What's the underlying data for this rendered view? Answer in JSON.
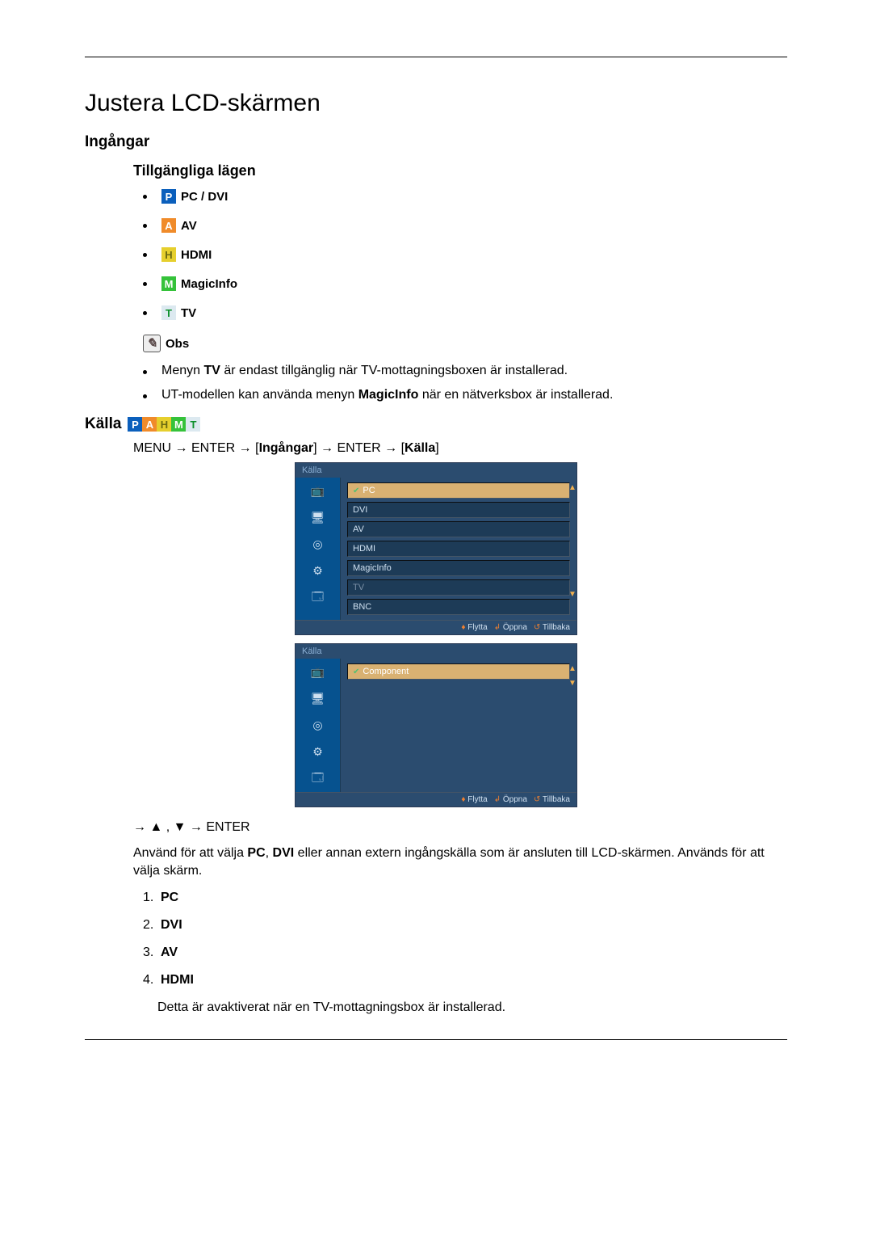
{
  "page_title": "Justera LCD-skärmen",
  "section_ingangar": "Ingångar",
  "subsection_tillgangliga": "Tillgängliga lägen",
  "modes": [
    {
      "letter": "P",
      "bg": "#0b5fbc",
      "fg": "#fff",
      "label": "PC / DVI"
    },
    {
      "letter": "A",
      "bg": "#f08b2a",
      "fg": "#fff",
      "label": "AV"
    },
    {
      "letter": "H",
      "bg": "#e6cf2d",
      "fg": "#6b6a11",
      "label": "HDMI"
    },
    {
      "letter": "M",
      "bg": "#35c23a",
      "fg": "#fff",
      "label": "MagicInfo"
    },
    {
      "letter": "T",
      "bg": "#dce9f0",
      "fg": "#0b8f2a",
      "label": "TV"
    }
  ],
  "obs": {
    "label": "Obs"
  },
  "notes": [
    {
      "pre": "Menyn ",
      "bold1": "TV",
      "mid1": " är endast tillgänglig när TV-mottagningsboxen är installerad.",
      "bold2": "",
      "mid2": ""
    },
    {
      "pre": "UT-modellen kan använda menyn ",
      "bold1": "MagicInfo",
      "mid1": " när en nätverksbox är installerad.",
      "bold2": "",
      "mid2": ""
    }
  ],
  "kalla_label": "Källa",
  "kalla_icons": [
    {
      "letter": "P",
      "bg": "#0b5fbc",
      "fg": "#fff"
    },
    {
      "letter": "A",
      "bg": "#f08b2a",
      "fg": "#fff"
    },
    {
      "letter": "H",
      "bg": "#e6cf2d",
      "fg": "#6b6a11"
    },
    {
      "letter": "M",
      "bg": "#35c23a",
      "fg": "#fff"
    },
    {
      "letter": "T",
      "bg": "#dce9f0",
      "fg": "#0b8f2a"
    }
  ],
  "menu_path": {
    "p1": "MENU → ENTER → [",
    "b1": "Ingångar",
    "p2": "] → ENTER → [",
    "b2": "Källa",
    "p3": "]"
  },
  "osd1": {
    "title": "Källa",
    "rows": [
      {
        "label": "PC",
        "sel": true,
        "mark": true,
        "dim": false
      },
      {
        "label": "DVI",
        "sel": false,
        "mark": false,
        "dim": false
      },
      {
        "label": "AV",
        "sel": false,
        "mark": false,
        "dim": false
      },
      {
        "label": "HDMI",
        "sel": false,
        "mark": false,
        "dim": false
      },
      {
        "label": "MagicInfo",
        "sel": false,
        "mark": false,
        "dim": false
      },
      {
        "label": "TV",
        "sel": false,
        "mark": false,
        "dim": true
      },
      {
        "label": "BNC",
        "sel": false,
        "mark": false,
        "dim": false
      }
    ],
    "foot_flytta": "Flytta",
    "foot_oppna": "Öppna",
    "foot_tillbaka": "Tillbaka"
  },
  "osd2": {
    "title": "Källa",
    "rows": [
      {
        "label": "Component",
        "sel": true,
        "mark": true,
        "dim": false
      }
    ],
    "foot_flytta": "Flytta",
    "foot_oppna": "Öppna",
    "foot_tillbaka": "Tillbaka"
  },
  "nav_line": "→ ▲ , ▼ → ENTER",
  "body_text": {
    "pre": "Använd för att välja ",
    "b1": "PC",
    "mid1": ", ",
    "b2": "DVI",
    "mid2": " eller annan extern ingångskälla som är ansluten till LCD-skärmen. Används för att välja skärm."
  },
  "num_list": [
    {
      "n": "1.",
      "label": "PC"
    },
    {
      "n": "2.",
      "label": "DVI"
    },
    {
      "n": "3.",
      "label": "AV"
    },
    {
      "n": "4.",
      "label": "HDMI"
    }
  ],
  "foot_text": "Detta är avaktiverat när en TV-mottagningsbox är installerad."
}
